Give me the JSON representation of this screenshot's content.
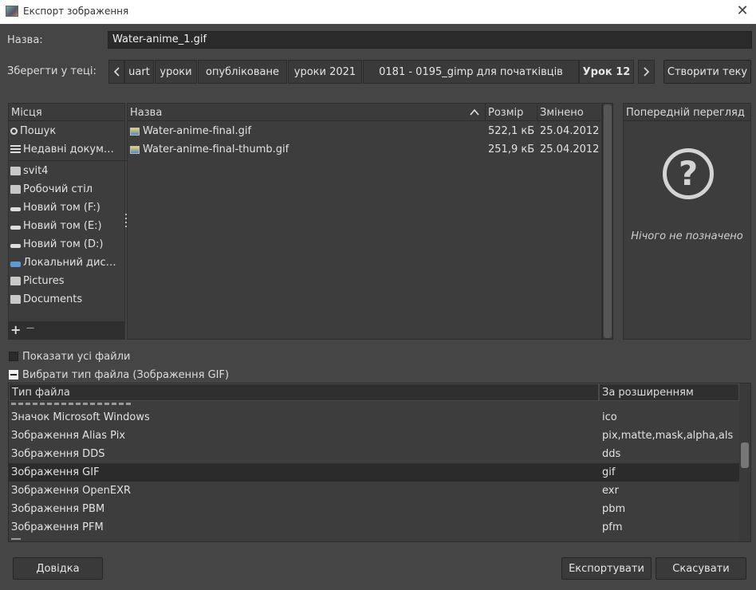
{
  "window": {
    "title": "Експорт зображення",
    "close_glyph": "✕"
  },
  "name_field": {
    "label": "Назва:",
    "value": "Water-anime_1.gif"
  },
  "save_in": {
    "label": "Зберегти у теці:",
    "crumbs": [
      "uart",
      "уроки",
      "опубліковане",
      "уроки 2021",
      "0181 - 0195_gimp для початківців",
      "Урок 12"
    ],
    "create_folder": "Створити теку"
  },
  "places": {
    "header": "Місця",
    "items": [
      {
        "label": "Пошук",
        "icon": "search-icon"
      },
      {
        "label": "Недавні докум…",
        "icon": "recent-icon"
      },
      {
        "label": "svit4",
        "icon": "folder-icon"
      },
      {
        "label": "Робочий стіл",
        "icon": "folder-icon"
      },
      {
        "label": "Новий том (F:)",
        "icon": "drive-icon"
      },
      {
        "label": "Новий том (E:)",
        "icon": "drive-icon"
      },
      {
        "label": "Новий том (D:)",
        "icon": "drive-icon"
      },
      {
        "label": "Локальний дис…",
        "icon": "local-drive-icon"
      },
      {
        "label": "Pictures",
        "icon": "folder-icon"
      },
      {
        "label": "Documents",
        "icon": "folder-icon"
      }
    ],
    "add_glyph": "+",
    "remove_glyph": "—"
  },
  "files": {
    "columns": {
      "name": "Назва",
      "size": "Розмір",
      "modified": "Змінено"
    },
    "rows": [
      {
        "name": "Water-anime-final.gif",
        "size": "522,1 кБ",
        "modified": "25.04.2012"
      },
      {
        "name": "Water-anime-final-thumb.gif",
        "size": "251,9 кБ",
        "modified": "25.04.2012"
      }
    ]
  },
  "preview": {
    "header": "Попередній перегляд",
    "icon_glyph": "?",
    "empty_text": "Нічого не позначено"
  },
  "show_all_files": {
    "label": "Показати усі файли",
    "checked": false
  },
  "file_type": {
    "expander_label": "Вибрати тип файла (Зображення GIF)",
    "columns": {
      "type": "Тип файла",
      "ext": "За розширенням"
    },
    "rows": [
      {
        "type": "Значок Microsoft Windows",
        "ext": "ico"
      },
      {
        "type": "Зображення Alias Pix",
        "ext": "pix,matte,mask,alpha,als"
      },
      {
        "type": "Зображення DDS",
        "ext": "dds"
      },
      {
        "type": "Зображення GIF",
        "ext": "gif",
        "selected": true
      },
      {
        "type": "Зображення OpenEXR",
        "ext": "exr"
      },
      {
        "type": "Зображення PBM",
        "ext": "pbm"
      },
      {
        "type": "Зображення PFM",
        "ext": "pfm"
      }
    ]
  },
  "buttons": {
    "help": "Довідка",
    "export": "Експортувати",
    "cancel": "Скасувати"
  }
}
